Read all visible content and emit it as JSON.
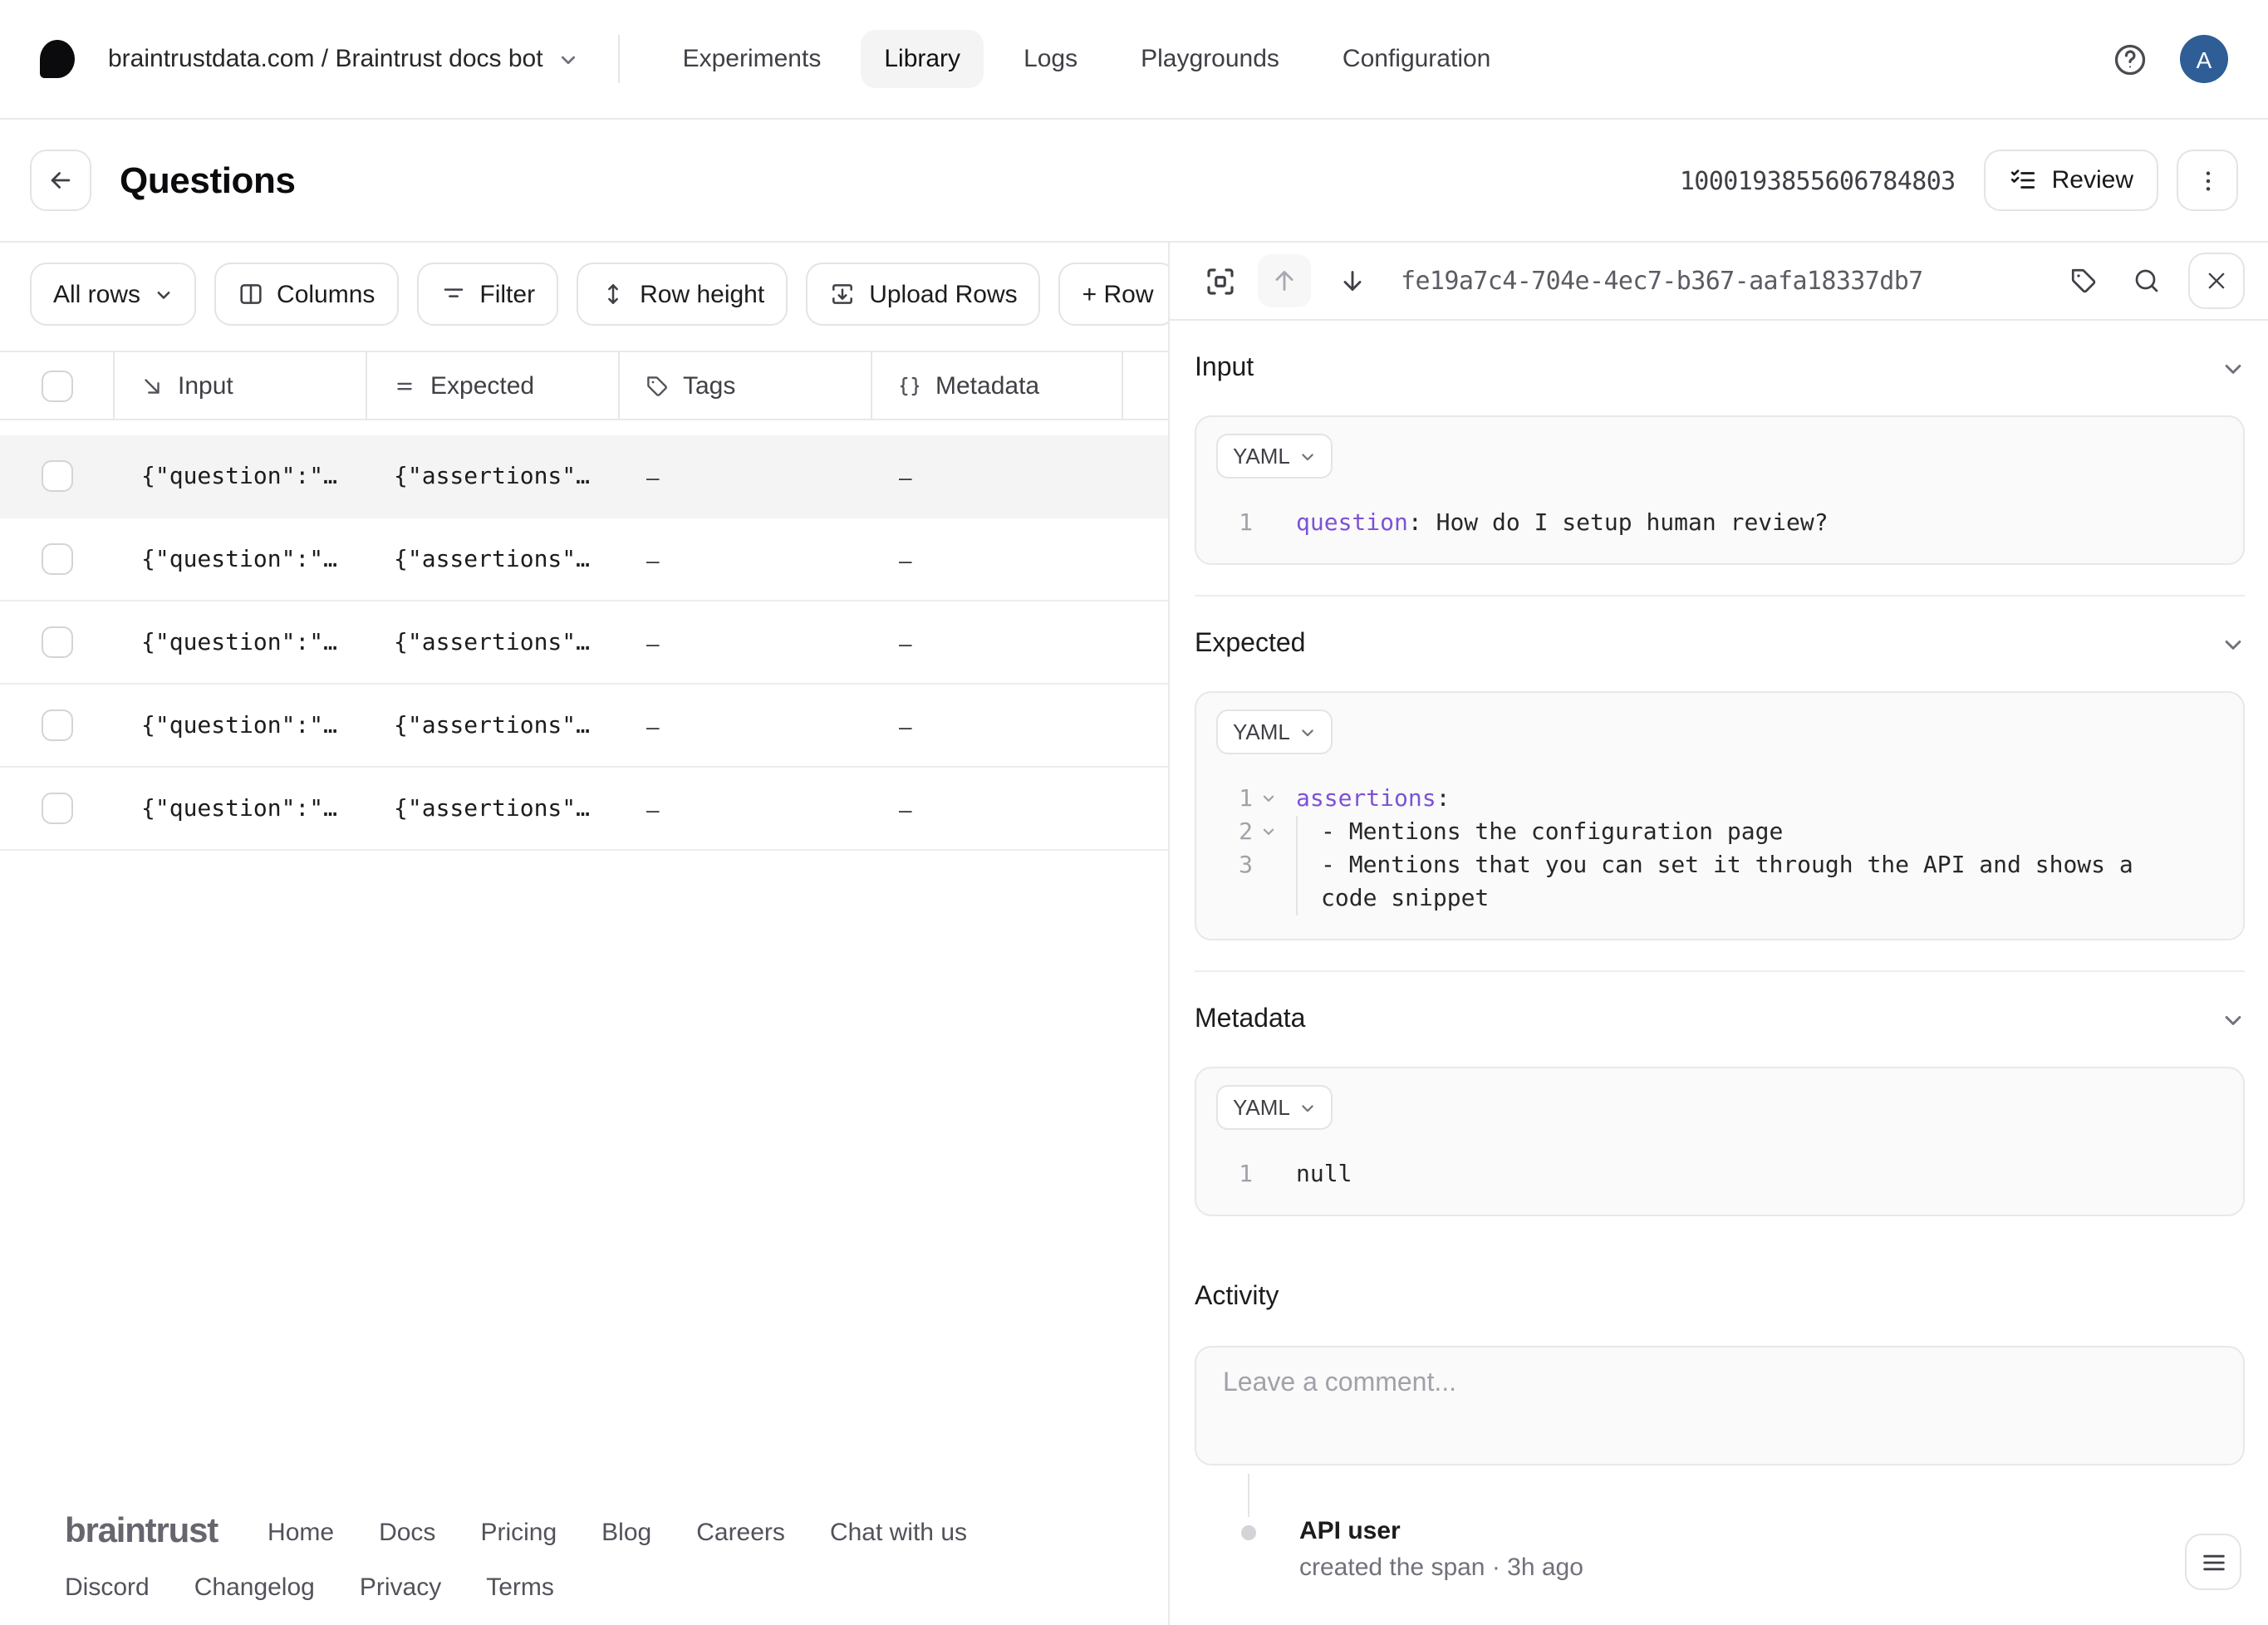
{
  "nav": {
    "breadcrumb": "braintrustdata.com / Braintrust docs bot",
    "items": [
      {
        "label": "Experiments",
        "active": false
      },
      {
        "label": "Library",
        "active": true
      },
      {
        "label": "Logs",
        "active": false
      },
      {
        "label": "Playgrounds",
        "active": false
      },
      {
        "label": "Configuration",
        "active": false
      }
    ],
    "avatar_letter": "A"
  },
  "header": {
    "title": "Questions",
    "dataset_id": "1000193855606784803",
    "review_label": "Review"
  },
  "toolbar": {
    "all_rows": "All rows",
    "columns": "Columns",
    "filter": "Filter",
    "row_height": "Row height",
    "upload_rows": "Upload Rows",
    "add_row": "+ Row"
  },
  "table": {
    "columns": {
      "input": "Input",
      "expected": "Expected",
      "tags": "Tags",
      "metadata": "Metadata"
    },
    "rows": [
      {
        "input": "{\"question\":\"…",
        "expected": "{\"assertions\"…",
        "tags": "–",
        "metadata": "–",
        "selected": true
      },
      {
        "input": "{\"question\":\"…",
        "expected": "{\"assertions\"…",
        "tags": "–",
        "metadata": "–",
        "selected": false
      },
      {
        "input": "{\"question\":\"…",
        "expected": "{\"assertions\"…",
        "tags": "–",
        "metadata": "–",
        "selected": false
      },
      {
        "input": "{\"question\":\"…",
        "expected": "{\"assertions\"…",
        "tags": "–",
        "metadata": "–",
        "selected": false
      },
      {
        "input": "{\"question\":\"…",
        "expected": "{\"assertions\"…",
        "tags": "–",
        "metadata": "–",
        "selected": false
      }
    ]
  },
  "panel": {
    "row_id": "fe19a7c4-704e-4ec7-b367-aafa18337db7",
    "sections": [
      {
        "key": "input",
        "label": "Input",
        "format": "YAML",
        "bordered": true,
        "lines": [
          {
            "num": "1",
            "fold": false,
            "indent": false,
            "tokens": [
              {
                "type": "key",
                "text": "question"
              },
              {
                "type": "plain",
                "text": ": How do I setup human review?"
              }
            ]
          }
        ]
      },
      {
        "key": "expected",
        "label": "Expected",
        "format": "YAML",
        "bordered": true,
        "lines": [
          {
            "num": "1",
            "fold": true,
            "indent": false,
            "tokens": [
              {
                "type": "key",
                "text": "assertions"
              },
              {
                "type": "plain",
                "text": ":"
              }
            ]
          },
          {
            "num": "2",
            "fold": true,
            "indent": true,
            "tokens": [
              {
                "type": "plain",
                "text": "- Mentions the configuration page"
              }
            ]
          },
          {
            "num": "3",
            "fold": false,
            "indent": true,
            "tokens": [
              {
                "type": "plain",
                "text": "- Mentions that you can set it through the API and shows a code snippet"
              }
            ]
          }
        ]
      },
      {
        "key": "metadata",
        "label": "Metadata",
        "format": "YAML",
        "bordered": false,
        "lines": [
          {
            "num": "1",
            "fold": false,
            "indent": false,
            "tokens": [
              {
                "type": "plain",
                "text": "null"
              }
            ]
          }
        ]
      }
    ],
    "activity": {
      "label": "Activity",
      "comment_placeholder": "Leave a comment...",
      "event_user": "API user",
      "event_desc": "created the span · 3h ago"
    }
  },
  "footer": {
    "brand": "braintrust",
    "links_row1": [
      "Home",
      "Docs",
      "Pricing",
      "Blog",
      "Careers",
      "Chat with us"
    ],
    "links_row2": [
      "Discord",
      "Changelog",
      "Privacy",
      "Terms"
    ]
  },
  "colors": {
    "accent_key": "#7c52d6",
    "avatar_bg": "#2e5e95",
    "selected_row_bg": "#f4f4f5",
    "border": "#e4e4e7",
    "code_bg": "#fafafa"
  }
}
